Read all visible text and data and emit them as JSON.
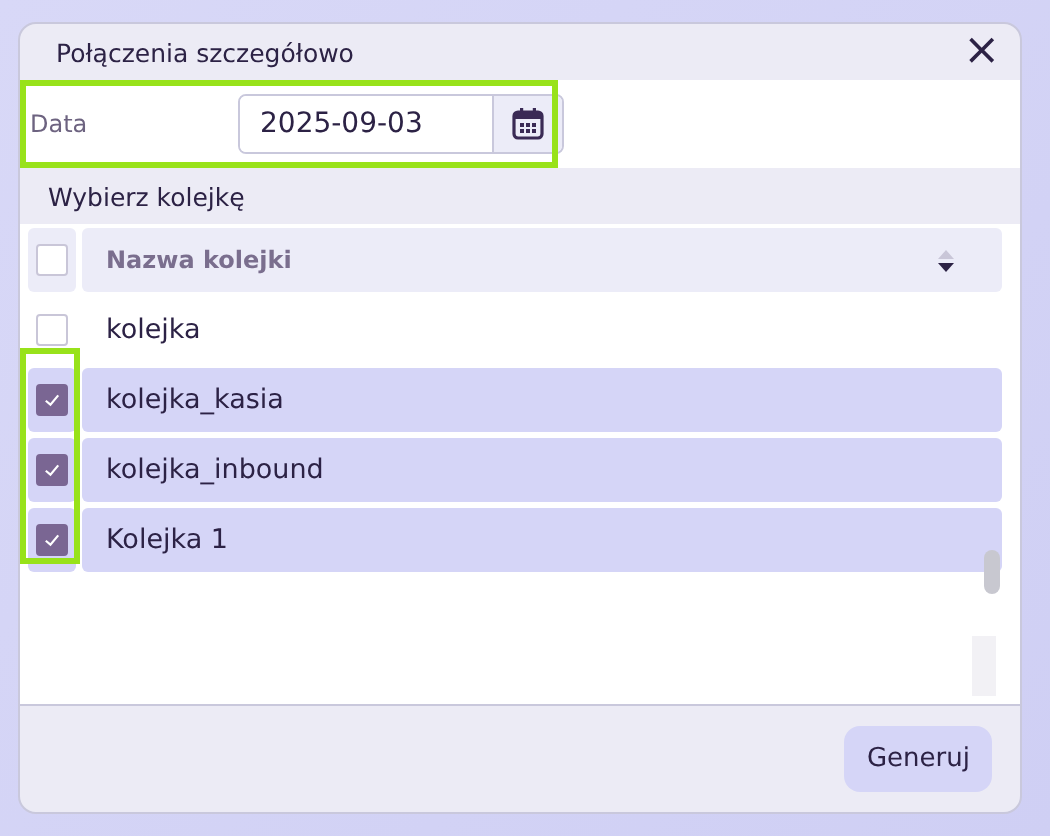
{
  "dialog": {
    "title": "Połączenia szczegółowo",
    "close": "×"
  },
  "date": {
    "label": "Data",
    "value": "2025-09-03"
  },
  "section_title": "Wybierz kolejkę",
  "table": {
    "header": {
      "checked": false,
      "column": "Nazwa kolejki"
    },
    "rows": [
      {
        "name": "kolejka",
        "checked": false
      },
      {
        "name": "kolejka_kasia",
        "checked": true
      },
      {
        "name": "kolejka_inbound",
        "checked": true
      },
      {
        "name": "Kolejka 1",
        "checked": true
      }
    ]
  },
  "buttons": [
    "Generuj"
  ]
}
